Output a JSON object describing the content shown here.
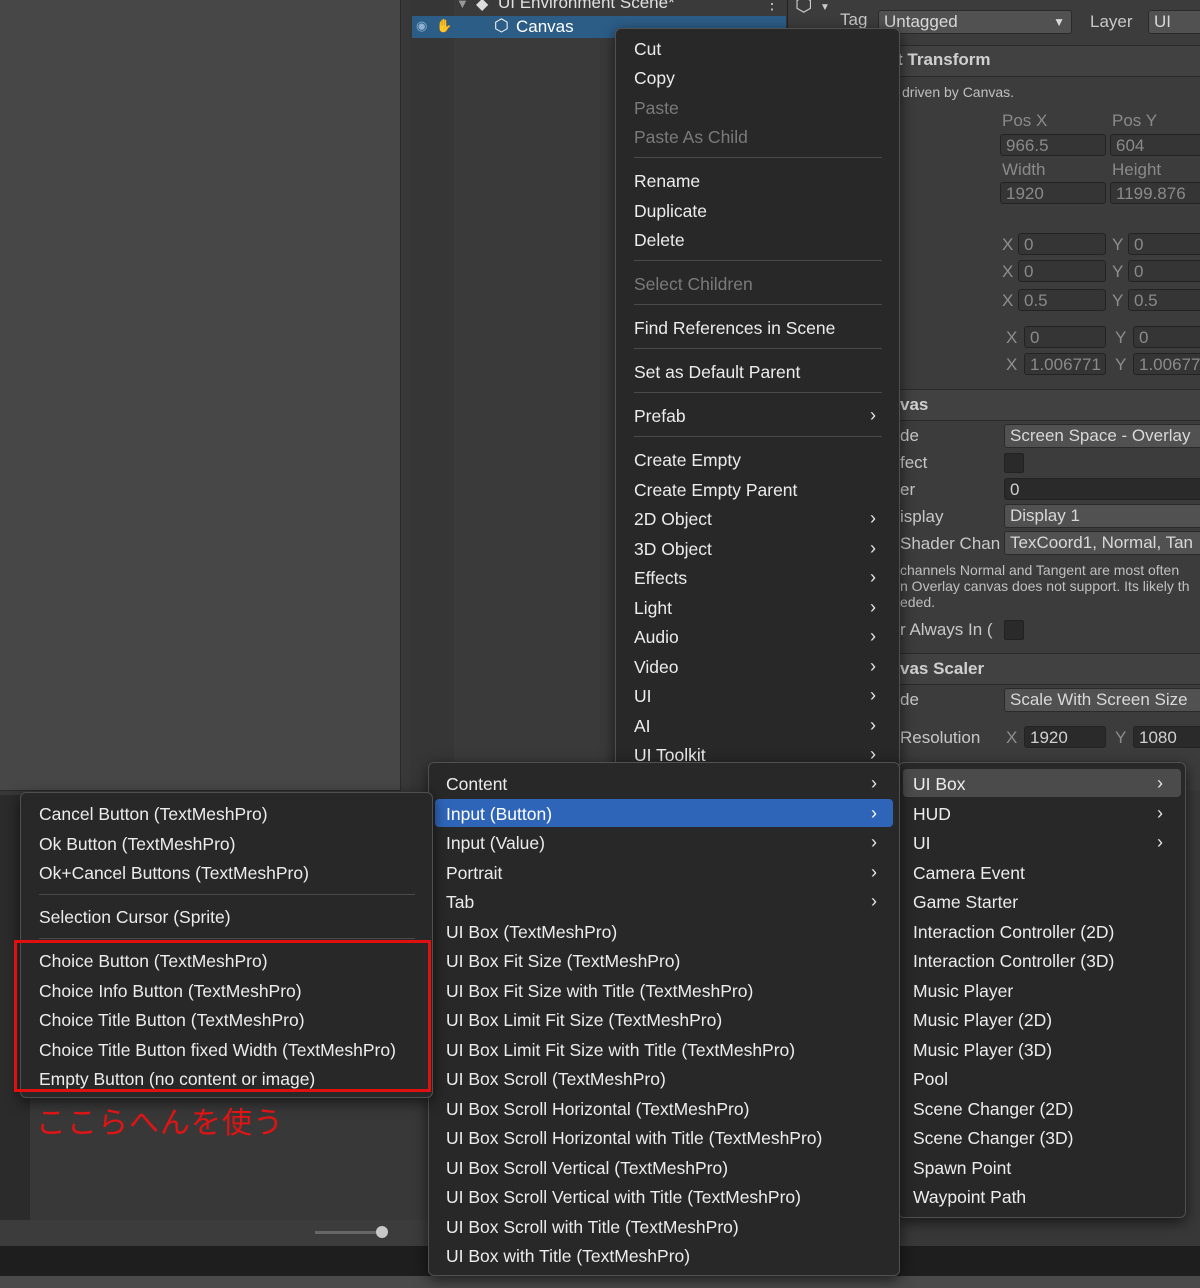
{
  "hierarchy": {
    "scene_title": "UI Environment Scene*",
    "kebab": "⋮",
    "selected_item": "Canvas"
  },
  "inspector": {
    "tag_label": "Tag",
    "tag_value": "Untagged",
    "layer_label": "Layer",
    "layer_value": "UI",
    "rect_transform_title": "t Transform",
    "driven_note": "driven by Canvas.",
    "pos_x_label": "Pos X",
    "pos_y_label": "Pos Y",
    "pos_x": "966.5",
    "pos_y": "604",
    "width_label": "Width",
    "height_label": "Height",
    "width": "1920",
    "height": "1199.876",
    "anchor_min_x": "0",
    "anchor_min_y": "0",
    "anchor_max_x": "0",
    "anchor_max_y": "0",
    "pivot_x": "0.5",
    "pivot_y": "0.5",
    "rotation_x": "0",
    "rotation_y": "0",
    "scale_x": "1.006771",
    "scale_y": "1.00677",
    "axis_x": "X",
    "axis_y": "Y",
    "canvas_title": "vas",
    "render_mode_label": "de",
    "render_mode_value": "Screen Space - Overlay",
    "pixel_perfect_label": "fect",
    "sort_order_label": "er",
    "sort_order_value": "0",
    "target_display_label": "isplay",
    "target_display_value": "Display 1",
    "shader_label": "Shader Chan",
    "shader_value": "TexCoord1, Normal, Tan",
    "shader_note_1": "channels Normal and Tangent are most often",
    "shader_note_2": "n Overlay canvas does not support. Its likely th",
    "shader_note_3": "eded.",
    "vertex_label": "r Always In (",
    "scaler_title": "vas Scaler",
    "scale_mode_label": "de",
    "scale_mode_value": "Scale With Screen Size",
    "resolution_label": "Resolution",
    "res_x": "1920",
    "res_y": "1080"
  },
  "context_menu": {
    "items": [
      {
        "label": "Cut",
        "disabled": false
      },
      {
        "label": "Copy",
        "disabled": false
      },
      {
        "label": "Paste",
        "disabled": true
      },
      {
        "label": "Paste As Child",
        "disabled": true
      },
      {
        "label": "Rename",
        "disabled": false
      },
      {
        "label": "Duplicate",
        "disabled": false
      },
      {
        "label": "Delete",
        "disabled": false
      },
      {
        "label": "Select Children",
        "disabled": true
      },
      {
        "label": "Find References in Scene",
        "disabled": false
      },
      {
        "label": "Set as Default Parent",
        "disabled": false
      },
      {
        "label": "Prefab",
        "disabled": false
      },
      {
        "label": "Create Empty",
        "disabled": false
      },
      {
        "label": "Create Empty Parent",
        "disabled": false
      },
      {
        "label": "2D Object",
        "disabled": false
      },
      {
        "label": "3D Object",
        "disabled": false
      },
      {
        "label": "Effects",
        "disabled": false
      },
      {
        "label": "Light",
        "disabled": false
      },
      {
        "label": "Audio",
        "disabled": false
      },
      {
        "label": "Video",
        "disabled": false
      },
      {
        "label": "UI",
        "disabled": false
      },
      {
        "label": "AI",
        "disabled": false
      },
      {
        "label": "UI Toolkit",
        "disabled": false
      }
    ]
  },
  "tools_menu": {
    "items": [
      "UI Box",
      "HUD",
      "UI",
      "Camera Event",
      "Game Starter",
      "Interaction Controller (2D)",
      "Interaction Controller (3D)",
      "Music Player",
      "Music Player (2D)",
      "Music Player (3D)",
      "Pool",
      "Scene Changer (2D)",
      "Scene Changer (3D)",
      "Spawn Point",
      "Waypoint Path"
    ]
  },
  "uibox_menu": {
    "items": [
      "Content",
      "Input (Button)",
      "Input (Value)",
      "Portrait",
      "Tab",
      "UI Box (TextMeshPro)",
      "UI Box Fit Size (TextMeshPro)",
      "UI Box Fit Size with Title (TextMeshPro)",
      "UI Box Limit Fit Size (TextMeshPro)",
      "UI Box Limit Fit Size with Title (TextMeshPro)",
      "UI Box Scroll (TextMeshPro)",
      "UI Box Scroll Horizontal (TextMeshPro)",
      "UI Box Scroll Horizontal with Title (TextMeshPro)",
      "UI Box Scroll Vertical (TextMeshPro)",
      "UI Box Scroll Vertical with Title (TextMeshPro)",
      "UI Box Scroll with Title (TextMeshPro)",
      "UI Box with Title (TextMeshPro)"
    ]
  },
  "button_menu": {
    "items": [
      "Cancel Button (TextMeshPro)",
      "Ok Button (TextMeshPro)",
      "Ok+Cancel Buttons (TextMeshPro)",
      "Selection Cursor (Sprite)",
      "Choice Button (TextMeshPro)",
      "Choice Info Button (TextMeshPro)",
      "Choice Title Button (TextMeshPro)",
      "Choice Title Button fixed Width (TextMeshPro)",
      "Empty Button (no content or image)"
    ]
  },
  "annotation_text": "ここらへんを使う",
  "submenu_arrow": "›",
  "colors": {
    "highlight": "#2f65b8",
    "annotation": "#e01010",
    "menu_bg": "#282828"
  }
}
